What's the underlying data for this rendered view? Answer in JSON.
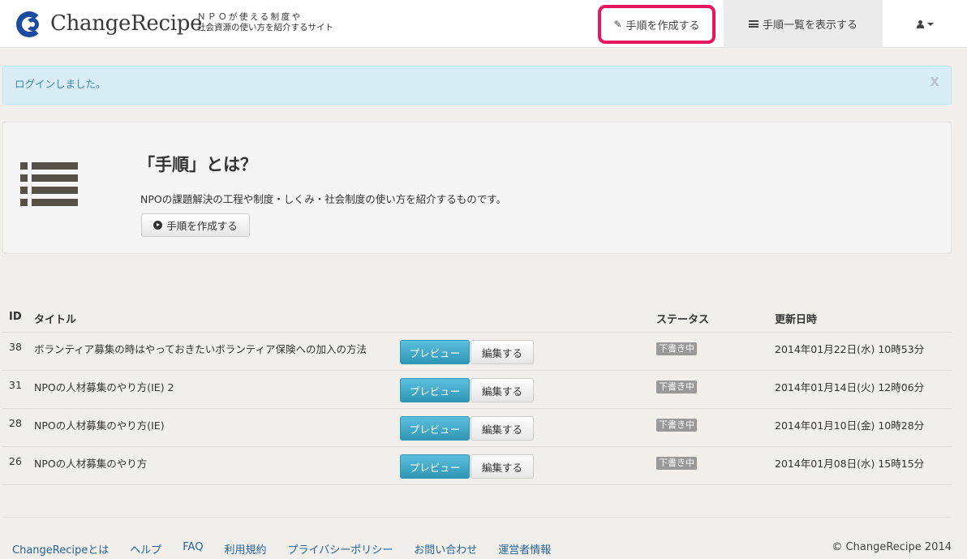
{
  "header": {
    "brand_name": "ChangeRecipe",
    "tagline_line1": "ＮＰＯが使える制度や",
    "tagline_line2": "社会資源の使い方を紹介するサイト",
    "nav_create": "手順を作成する",
    "nav_list": "手順一覧を表示する",
    "accent_color": "#e8155f"
  },
  "alert": {
    "message": "ログインしました。",
    "close": "X"
  },
  "intro": {
    "title": "「手順」とは？",
    "description": "NPOの課題解決の工程や制度・しくみ・社会制度の使い方を紹介するものです。",
    "button": "手順を作成する"
  },
  "table": {
    "headers": {
      "id": "ID",
      "title": "タイトル",
      "status": "ステータス",
      "updated": "更新日時"
    },
    "preview_label": "プレビュー",
    "edit_label": "編集する",
    "rows": [
      {
        "id": "38",
        "title": "ボランティア募集の時はやっておきたいボランティア保険への加入の方法",
        "status": "下書き中",
        "updated": "2014年01月22日(水) 10時53分"
      },
      {
        "id": "31",
        "title": "NPOの人材募集のやり方(IE) 2",
        "status": "下書き中",
        "updated": "2014年01月14日(火) 12時06分"
      },
      {
        "id": "28",
        "title": "NPOの人材募集のやり方(IE)",
        "status": "下書き中",
        "updated": "2014年01月10日(金) 10時28分"
      },
      {
        "id": "26",
        "title": "NPOの人材募集のやり方",
        "status": "下書き中",
        "updated": "2014年01月08日(水) 15時15分"
      }
    ]
  },
  "footer": {
    "links": [
      "ChangeRecipeとは",
      "ヘルプ",
      "FAQ",
      "利用規約",
      "プライバシーポリシー",
      "お問い合わせ",
      "運営者情報"
    ],
    "copyright": "© ChangeRecipe 2014"
  }
}
